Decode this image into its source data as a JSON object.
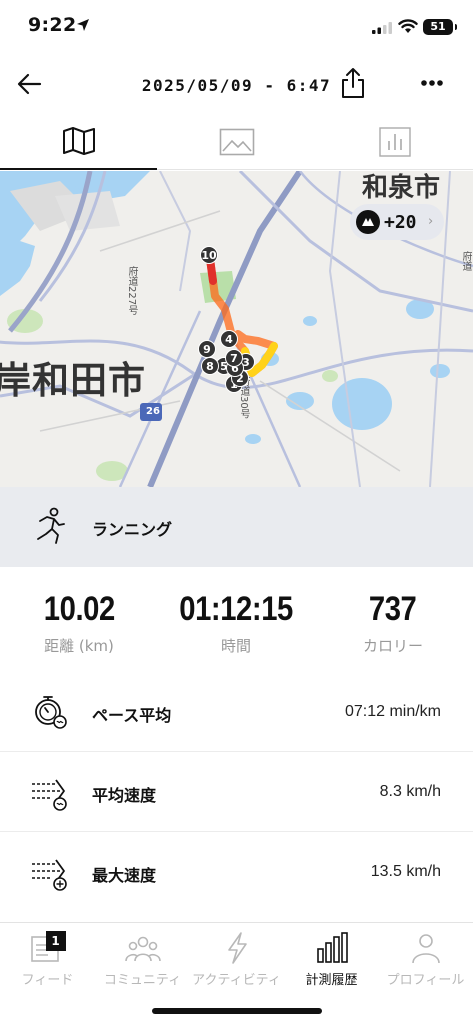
{
  "status_bar": {
    "time": "9:22",
    "battery": "51"
  },
  "header": {
    "title": "2025/05/09 - 6:47"
  },
  "tabs": [
    {
      "icon": "map-icon",
      "active": true
    },
    {
      "icon": "image-icon",
      "active": false
    },
    {
      "icon": "bar-chart-icon",
      "active": false
    }
  ],
  "map": {
    "city_label_left": "岸和田市",
    "city_label_top_right": "和泉市",
    "route_number": "26",
    "road_label_1": "府道227号",
    "road_label_2": "府道30号",
    "road_label_3": "府道",
    "badge_count": "+20",
    "km_markers": [
      "1",
      "2",
      "3",
      "4",
      "5",
      "6",
      "7",
      "8",
      "9",
      "10"
    ]
  },
  "activity": {
    "label": "ランニング",
    "icon": "running-icon"
  },
  "summary": [
    {
      "value": "10.02",
      "label": "距離 (km)"
    },
    {
      "value": "01:12:15",
      "label": "時間"
    },
    {
      "value": "737",
      "label": "カロリー"
    }
  ],
  "metrics": [
    {
      "label": "ペース平均",
      "value": "07:12 min/km",
      "icon": "stopwatch-pace-icon"
    },
    {
      "label": "平均速度",
      "value": "8.3 km/h",
      "icon": "speed-average-icon"
    },
    {
      "label": "最大速度",
      "value": "13.5 km/h",
      "icon": "speed-max-icon"
    }
  ],
  "bottom_nav": [
    {
      "label": "フィード",
      "icon": "feed-icon",
      "badge": "1",
      "active": false
    },
    {
      "label": "コミュニティ",
      "icon": "community-icon",
      "active": false
    },
    {
      "label": "アクティビティ",
      "icon": "activity-bolt-icon",
      "active": false
    },
    {
      "label": "計測履歴",
      "icon": "history-chart-icon",
      "active": true
    },
    {
      "label": "プロフィール",
      "icon": "profile-icon",
      "active": false
    }
  ]
}
